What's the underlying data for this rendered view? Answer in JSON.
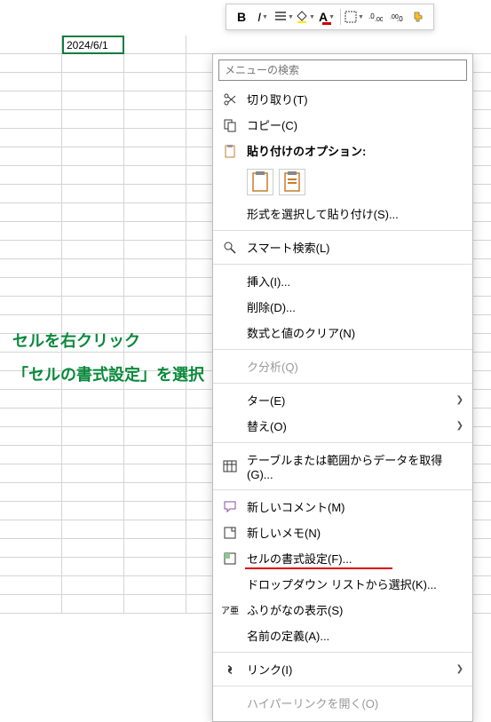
{
  "cell_value": "2024/6/1",
  "toolbar": {
    "bold": "B",
    "italic": "I"
  },
  "menu": {
    "search_placeholder": "メニューの検索",
    "cut": "切り取り(T)",
    "copy": "コピー(C)",
    "paste_options_heading": "貼り付けのオプション:",
    "paste_special": "形式を選択して貼り付け(S)...",
    "smart_lookup": "スマート検索(L)",
    "insert": "挿入(I)...",
    "delete": "削除(D)...",
    "clear": "数式と値のクリア(N)",
    "analysis": "ク分析(Q)",
    "filter": "ター(E)",
    "sort": "替え(O)",
    "get_data": "テーブルまたは範囲からデータを取得(G)...",
    "new_comment": "新しいコメント(M)",
    "new_note": "新しいメモ(N)",
    "format_cells": "セルの書式設定(F)...",
    "dropdown_select": "ドロップダウン リストから選択(K)...",
    "furigana": "ふりがなの表示(S)",
    "define_name": "名前の定義(A)...",
    "link": "リンク(I)",
    "open_hyperlink": "ハイパーリンクを開く(O)"
  },
  "annotation": {
    "line1": "セルを右クリック",
    "line2": "「セルの書式設定」を選択"
  }
}
